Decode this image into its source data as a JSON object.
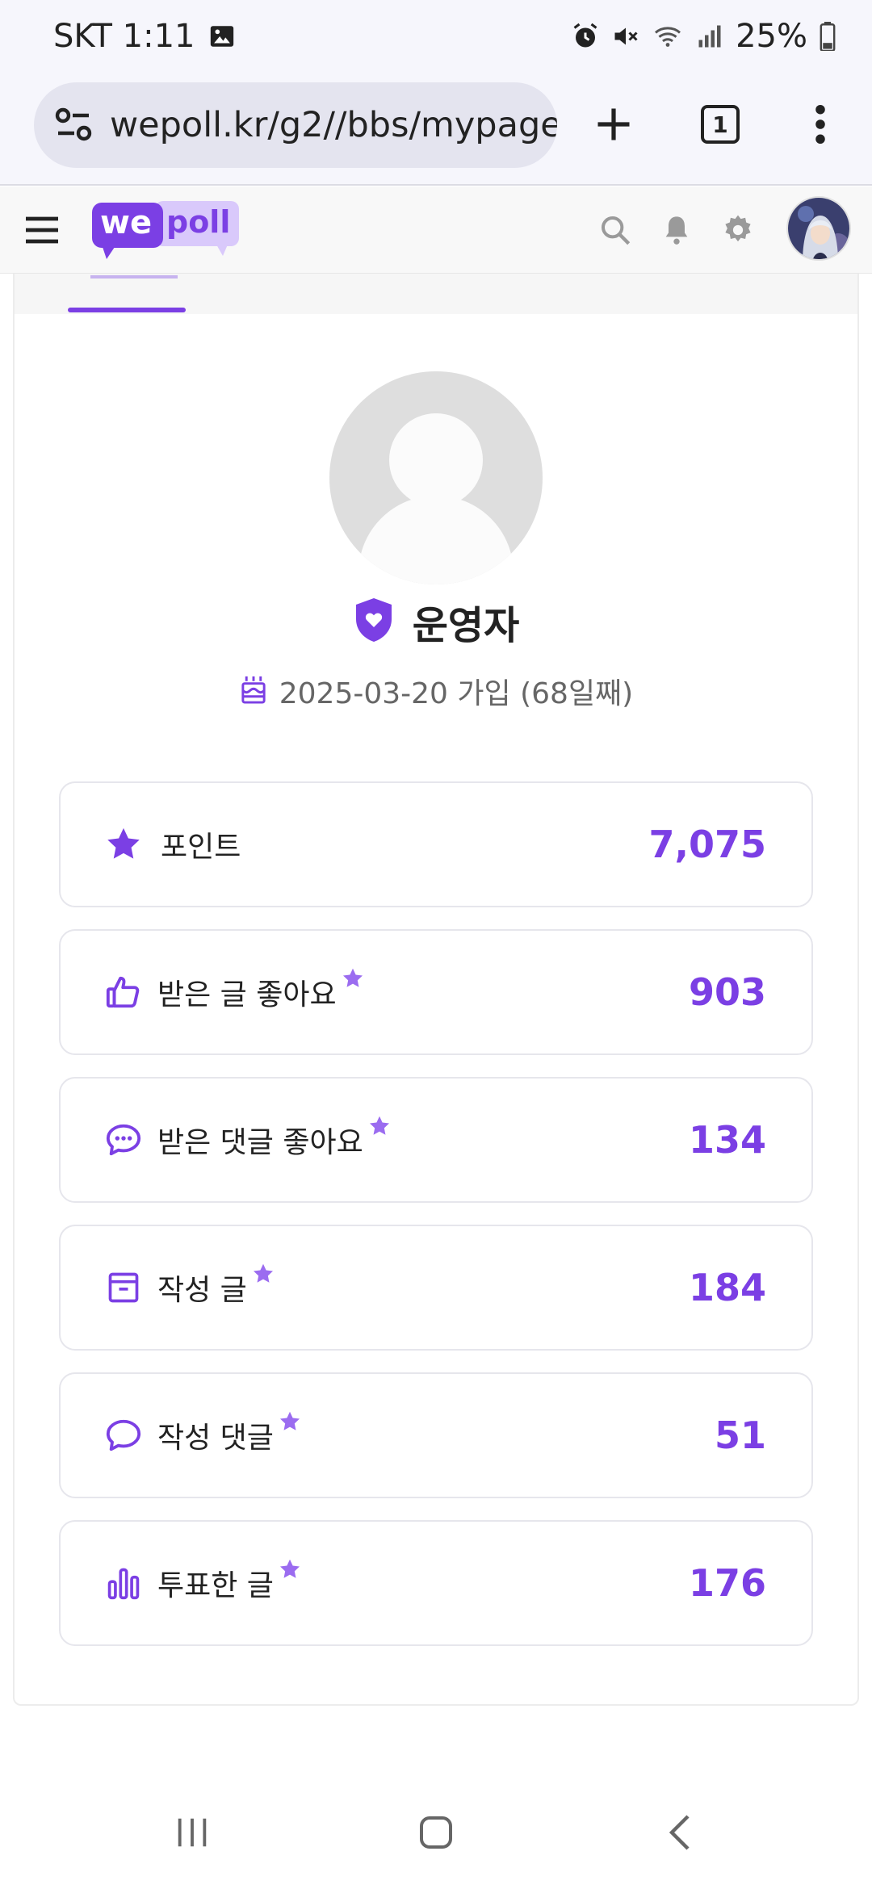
{
  "status_bar": {
    "carrier_time": "SKT 1:11",
    "battery": "25%"
  },
  "browser": {
    "url": "wepoll.kr/g2//bbs/mypage.p",
    "tab_count": "1"
  },
  "site": {
    "logo_we": "we",
    "logo_poll": "poll"
  },
  "profile": {
    "name": "운영자",
    "join_text": "2025-03-20 가입 (68일째)"
  },
  "stats": [
    {
      "icon": "star-icon",
      "label": "포인트",
      "value": "7,075",
      "starred": false
    },
    {
      "icon": "thumbs-up-icon",
      "label": "받은 글 좋아요",
      "value": "903",
      "starred": true
    },
    {
      "icon": "comment-dots-icon",
      "label": "받은 댓글 좋아요",
      "value": "134",
      "starred": true
    },
    {
      "icon": "archive-icon",
      "label": "작성 글",
      "value": "184",
      "starred": true
    },
    {
      "icon": "comment-icon",
      "label": "작성 댓글",
      "value": "51",
      "starred": true
    },
    {
      "icon": "bar-chart-icon",
      "label": "투표한 글",
      "value": "176",
      "starred": true
    }
  ],
  "colors": {
    "accent": "#7b3fe4",
    "star_badge": "#9b6cf0",
    "text": "#222222",
    "muted": "#666666"
  }
}
